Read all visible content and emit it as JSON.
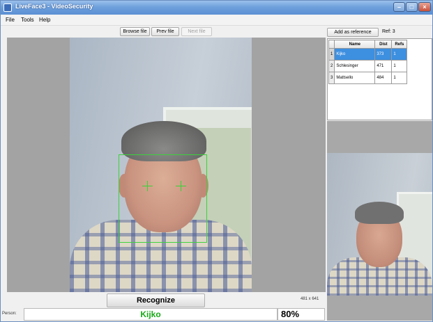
{
  "window": {
    "title": "LiveFace3 - VideoSecurity"
  },
  "menu": [
    "File",
    "Tools",
    "Help"
  ],
  "toolbar": {
    "browse": "Browse file",
    "prev": "Prev file",
    "next": "Next file"
  },
  "reference": {
    "add_label": "Add as reference",
    "count_label": "Ref: 3"
  },
  "grid": {
    "columns": [
      "Name",
      "Dist",
      "Refs"
    ],
    "rows": [
      {
        "index": "1",
        "name": "Kijko",
        "dist": "373",
        "refs": "1"
      },
      {
        "index": "2",
        "name": "Schlesinger",
        "dist": "471",
        "refs": "1"
      },
      {
        "index": "3",
        "name": "Mattsello",
        "dist": "484",
        "refs": "1"
      }
    ]
  },
  "recognize": {
    "label": "Recognize",
    "resolution": "481 x 641"
  },
  "result": {
    "person_label": "Person:",
    "name": "Kijko",
    "confidence": "80%"
  },
  "colors": {
    "match_green": "#17a817",
    "selected_row": "#3d8fe0",
    "face_box": "#3dd23d"
  }
}
